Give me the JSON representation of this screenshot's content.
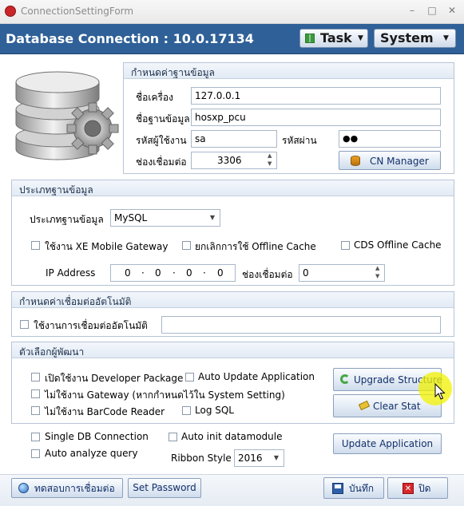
{
  "window": {
    "title": "ConnectionSettingForm",
    "minimize": "–",
    "maximize": "□",
    "close": "✕"
  },
  "header": {
    "title": "Database Connection : 10.0.17134",
    "task_label": "Task",
    "system_label": "System"
  },
  "db_settings": {
    "section_title": "กำหนดค่าฐานข้อมูล",
    "server_label": "ชื่อเครื่อง",
    "server_value": "127.0.0.1",
    "database_label": "ชื่อฐานข้อมูล",
    "database_value": "hosxp_pcu",
    "user_label": "รหัสผู้ใช้งาน",
    "user_value": "sa",
    "password_label": "รหัสผ่าน",
    "password_value": "●●",
    "port_label": "ช่องเชื่อมต่อ",
    "port_value": "3306",
    "cn_manager_label": "CN Manager"
  },
  "db_type": {
    "section_title": "ประเภทฐานข้อมูล",
    "type_label": "ประเภทฐานข้อมูล",
    "type_value": "MySQL",
    "xe_mobile_label": "ใช้งาน XE Mobile Gateway",
    "cancel_offline_label": "ยกเลิกการใช้ Offline Cache",
    "cds_offline_label": "CDS Offline Cache",
    "ip_label": "IP Address",
    "ip_octets": [
      "0",
      "0",
      "0",
      "0"
    ],
    "ip_port_label": "ช่องเชื่อมต่อ",
    "ip_port_value": "0"
  },
  "auto_connect": {
    "section_title": "กำหนดค่าเชื่อมต่ออัตโนมัติ",
    "use_label": "ใช้งานการเชื่อมต่ออัตโนมัติ",
    "value": ""
  },
  "dev_options": {
    "section_title": "ตัวเลือกผู้พัฒนา",
    "dev_package_label": "เปิดใช้งาน Developer Package",
    "auto_update_label": "Auto Update Application",
    "no_gateway_label": "ไม่ใช้งาน Gateway (หากกำหนดไว้ใน System Setting)",
    "no_barcode_label": "ไม่ใช้งาน BarCode Reader",
    "log_sql_label": "Log SQL",
    "upgrade_label": "Upgrade Structure",
    "clear_stat_label": "Clear Stat"
  },
  "misc": {
    "single_db_label": "Single DB Connection",
    "auto_init_label": "Auto init datamodule",
    "auto_analyze_label": "Auto analyze query",
    "ribbon_label": "Ribbon Style",
    "ribbon_value": "2016",
    "update_app_label": "Update Application"
  },
  "footer": {
    "test_label": "ทดสอบการเชื่อมต่อ",
    "set_password_label": "Set Password",
    "save_label": "บันทึก",
    "close_label": "ปิด"
  },
  "colors": {
    "header_bg": "#2f6098",
    "accent": "#13306a",
    "cursor_highlight": "#f2f200"
  }
}
